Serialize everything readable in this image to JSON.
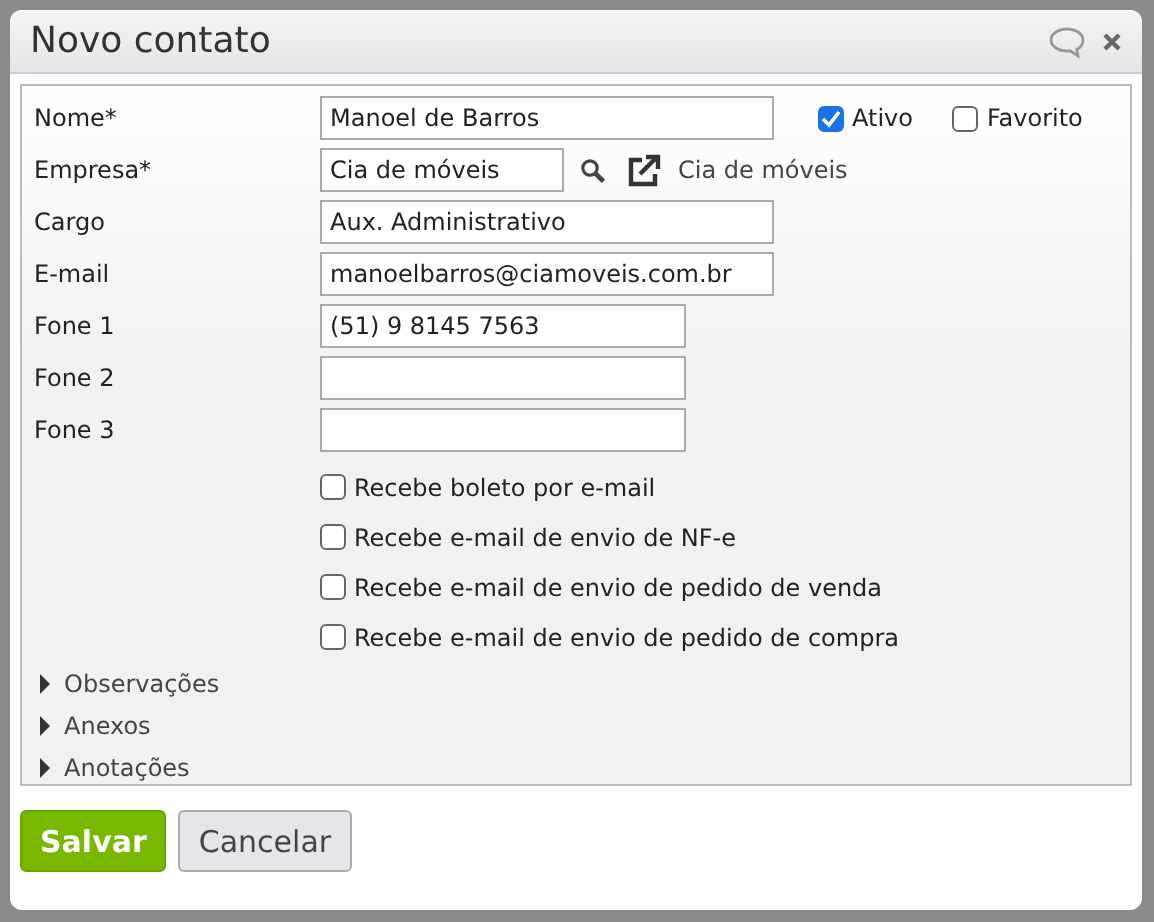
{
  "dialog": {
    "title": "Novo contato"
  },
  "fields": [
    {
      "kind": "text",
      "label": "Nome*",
      "value": "Manoel de Barros"
    },
    {
      "kind": "lookup",
      "label": "Empresa*",
      "value": "Cia de móveis",
      "link": "Cia de móveis"
    },
    {
      "kind": "text",
      "label": "Cargo",
      "value": "Aux. Administrativo"
    },
    {
      "kind": "text",
      "label": "E-mail",
      "value": "manoelbarros@ciamoveis.com.br"
    },
    {
      "kind": "phone",
      "label": "Fone 1",
      "value": "(51) 9 8145 7563"
    },
    {
      "kind": "phone",
      "label": "Fone 2"
    },
    {
      "kind": "phone",
      "label": "Fone 3"
    }
  ],
  "flags": [
    {
      "label": "Ativo",
      "checked": true
    },
    {
      "label": "Favorito",
      "checked": false
    }
  ],
  "options": [
    {
      "label": "Recebe boleto por e-mail",
      "checked": false
    },
    {
      "label": "Recebe e-mail de envio de NF-e",
      "checked": false
    },
    {
      "label": "Recebe e-mail de envio de pedido de venda",
      "checked": false
    },
    {
      "label": "Recebe e-mail de envio de pedido de compra",
      "checked": false
    }
  ],
  "sections": [
    {
      "label": "Observações",
      "expanded": false
    },
    {
      "label": "Anexos",
      "expanded": false
    },
    {
      "label": "Anotações",
      "expanded": false
    }
  ],
  "buttons": [
    {
      "kind": "primary",
      "label": "Salvar"
    },
    {
      "kind": "secondary",
      "label": "Cancelar"
    }
  ]
}
